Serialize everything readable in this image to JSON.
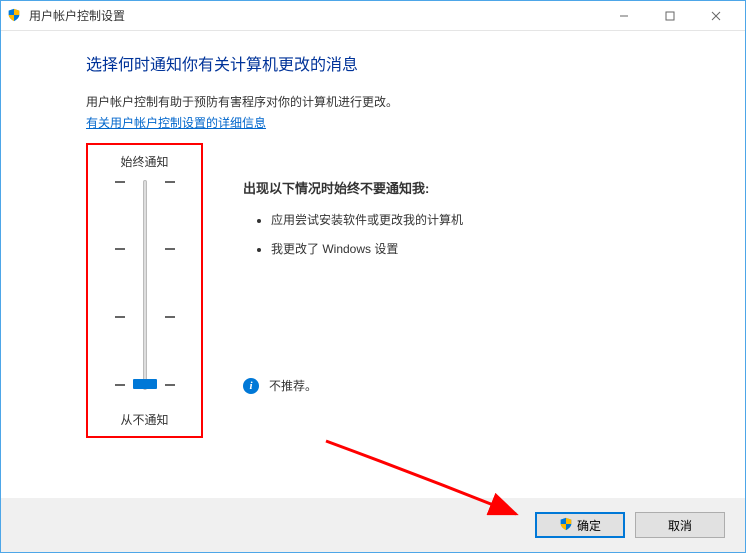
{
  "titlebar": {
    "title": "用户帐户控制设置"
  },
  "content": {
    "heading": "选择何时通知你有关计算机更改的消息",
    "description": "用户帐户控制有助于预防有害程序对你的计算机进行更改。",
    "link": "有关用户帐户控制设置的详细信息"
  },
  "slider": {
    "top_label": "始终通知",
    "bottom_label": "从不通知",
    "value": 0,
    "max": 3
  },
  "details": {
    "heading": "出现以下情况时始终不要通知我:",
    "bullets": [
      "应用尝试安装软件或更改我的计算机",
      "我更改了 Windows 设置"
    ],
    "recommendation": "不推荐。"
  },
  "footer": {
    "ok": "确定",
    "cancel": "取消"
  }
}
